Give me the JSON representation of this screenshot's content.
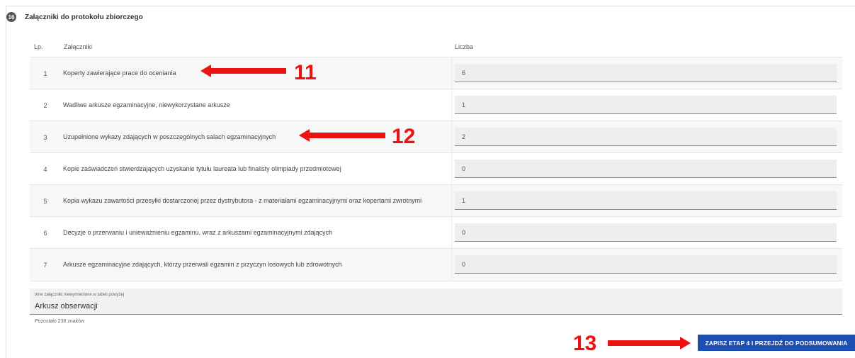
{
  "section": {
    "number": "16",
    "title": "Załączniki do protokołu zbiorczego"
  },
  "table": {
    "headers": {
      "lp": "Lp.",
      "attachments": "Załączniki",
      "count": "Liczba"
    },
    "rows": [
      {
        "lp": "1",
        "name": "Koperty zawierające prace do oceniania",
        "value": "6"
      },
      {
        "lp": "2",
        "name": "Wadliwe arkusze egzaminacyjne, niewykorzystane arkusze",
        "value": "1"
      },
      {
        "lp": "3",
        "name": "Uzupełnione wykazy zdających w poszczególnych salach egzaminacyjnych",
        "value": "2"
      },
      {
        "lp": "4",
        "name": "Kopie zaświadczeń stwierdzających uzyskanie tytułu laureata lub finalisty olimpiady przedmiotowej",
        "value": "0"
      },
      {
        "lp": "5",
        "name": "Kopia wykazu zawartości przesyłki dostarczonej przez dystrybutora - z materiałami egzaminacyjnymi oraz kopertami zwrotnymi",
        "value": "1"
      },
      {
        "lp": "6",
        "name": "Decyzje o przerwaniu i unieważnieniu egzaminu, wraz z arkuszami egzaminacyjnymi zdających",
        "value": "0"
      },
      {
        "lp": "7",
        "name": "Arkusze egzaminacyjne zdających, którzy przerwali egzamin z przyczyn losowych lub zdrowotnych",
        "value": "0"
      }
    ]
  },
  "other_attachments": {
    "label": "Inne załączniki niewymienione w tabeli powyżej",
    "value": "Arkusz obserwacji",
    "remaining": "Pozostało 238 znaków"
  },
  "annotations": {
    "a11": "11",
    "a12": "12",
    "a13": "13"
  },
  "save_button": {
    "label": "ZAPISZ ETAP 4 I PRZEJDŹ DO PODSUMOWANIA"
  },
  "colors": {
    "accent": "#1d4fb3",
    "annotation": "#ee1111"
  }
}
